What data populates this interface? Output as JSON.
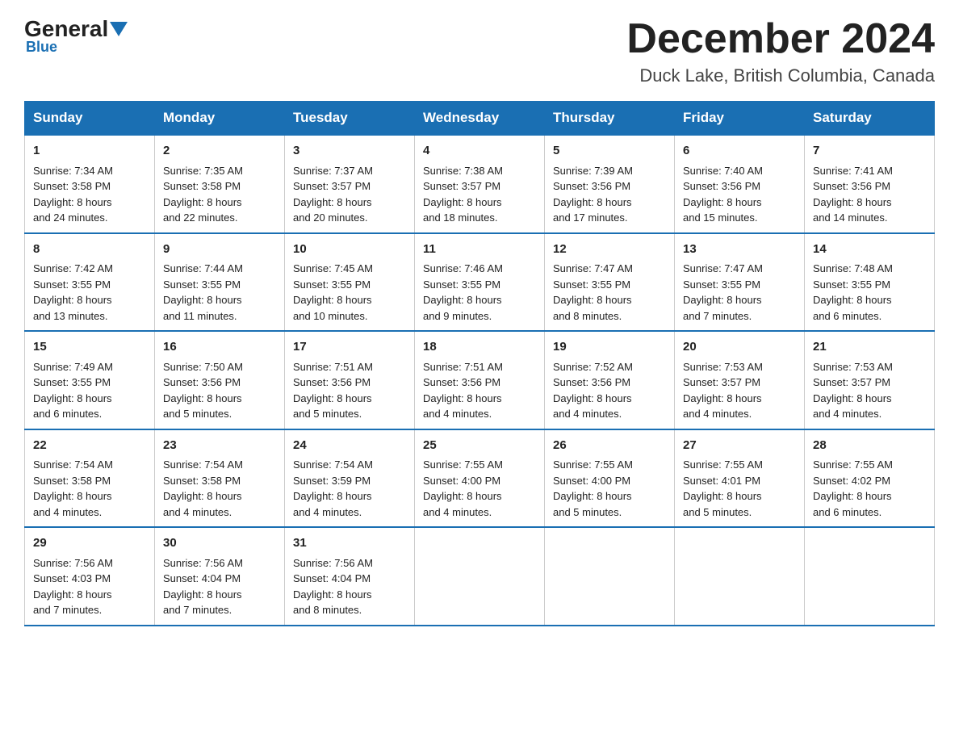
{
  "header": {
    "logo_general": "General",
    "logo_blue": "Blue",
    "month_title": "December 2024",
    "location": "Duck Lake, British Columbia, Canada"
  },
  "weekdays": [
    "Sunday",
    "Monday",
    "Tuesday",
    "Wednesday",
    "Thursday",
    "Friday",
    "Saturday"
  ],
  "weeks": [
    [
      {
        "day": "1",
        "sunrise": "7:34 AM",
        "sunset": "3:58 PM",
        "daylight": "8 hours and 24 minutes."
      },
      {
        "day": "2",
        "sunrise": "7:35 AM",
        "sunset": "3:58 PM",
        "daylight": "8 hours and 22 minutes."
      },
      {
        "day": "3",
        "sunrise": "7:37 AM",
        "sunset": "3:57 PM",
        "daylight": "8 hours and 20 minutes."
      },
      {
        "day": "4",
        "sunrise": "7:38 AM",
        "sunset": "3:57 PM",
        "daylight": "8 hours and 18 minutes."
      },
      {
        "day": "5",
        "sunrise": "7:39 AM",
        "sunset": "3:56 PM",
        "daylight": "8 hours and 17 minutes."
      },
      {
        "day": "6",
        "sunrise": "7:40 AM",
        "sunset": "3:56 PM",
        "daylight": "8 hours and 15 minutes."
      },
      {
        "day": "7",
        "sunrise": "7:41 AM",
        "sunset": "3:56 PM",
        "daylight": "8 hours and 14 minutes."
      }
    ],
    [
      {
        "day": "8",
        "sunrise": "7:42 AM",
        "sunset": "3:55 PM",
        "daylight": "8 hours and 13 minutes."
      },
      {
        "day": "9",
        "sunrise": "7:44 AM",
        "sunset": "3:55 PM",
        "daylight": "8 hours and 11 minutes."
      },
      {
        "day": "10",
        "sunrise": "7:45 AM",
        "sunset": "3:55 PM",
        "daylight": "8 hours and 10 minutes."
      },
      {
        "day": "11",
        "sunrise": "7:46 AM",
        "sunset": "3:55 PM",
        "daylight": "8 hours and 9 minutes."
      },
      {
        "day": "12",
        "sunrise": "7:47 AM",
        "sunset": "3:55 PM",
        "daylight": "8 hours and 8 minutes."
      },
      {
        "day": "13",
        "sunrise": "7:47 AM",
        "sunset": "3:55 PM",
        "daylight": "8 hours and 7 minutes."
      },
      {
        "day": "14",
        "sunrise": "7:48 AM",
        "sunset": "3:55 PM",
        "daylight": "8 hours and 6 minutes."
      }
    ],
    [
      {
        "day": "15",
        "sunrise": "7:49 AM",
        "sunset": "3:55 PM",
        "daylight": "8 hours and 6 minutes."
      },
      {
        "day": "16",
        "sunrise": "7:50 AM",
        "sunset": "3:56 PM",
        "daylight": "8 hours and 5 minutes."
      },
      {
        "day": "17",
        "sunrise": "7:51 AM",
        "sunset": "3:56 PM",
        "daylight": "8 hours and 5 minutes."
      },
      {
        "day": "18",
        "sunrise": "7:51 AM",
        "sunset": "3:56 PM",
        "daylight": "8 hours and 4 minutes."
      },
      {
        "day": "19",
        "sunrise": "7:52 AM",
        "sunset": "3:56 PM",
        "daylight": "8 hours and 4 minutes."
      },
      {
        "day": "20",
        "sunrise": "7:53 AM",
        "sunset": "3:57 PM",
        "daylight": "8 hours and 4 minutes."
      },
      {
        "day": "21",
        "sunrise": "7:53 AM",
        "sunset": "3:57 PM",
        "daylight": "8 hours and 4 minutes."
      }
    ],
    [
      {
        "day": "22",
        "sunrise": "7:54 AM",
        "sunset": "3:58 PM",
        "daylight": "8 hours and 4 minutes."
      },
      {
        "day": "23",
        "sunrise": "7:54 AM",
        "sunset": "3:58 PM",
        "daylight": "8 hours and 4 minutes."
      },
      {
        "day": "24",
        "sunrise": "7:54 AM",
        "sunset": "3:59 PM",
        "daylight": "8 hours and 4 minutes."
      },
      {
        "day": "25",
        "sunrise": "7:55 AM",
        "sunset": "4:00 PM",
        "daylight": "8 hours and 4 minutes."
      },
      {
        "day": "26",
        "sunrise": "7:55 AM",
        "sunset": "4:00 PM",
        "daylight": "8 hours and 5 minutes."
      },
      {
        "day": "27",
        "sunrise": "7:55 AM",
        "sunset": "4:01 PM",
        "daylight": "8 hours and 5 minutes."
      },
      {
        "day": "28",
        "sunrise": "7:55 AM",
        "sunset": "4:02 PM",
        "daylight": "8 hours and 6 minutes."
      }
    ],
    [
      {
        "day": "29",
        "sunrise": "7:56 AM",
        "sunset": "4:03 PM",
        "daylight": "8 hours and 7 minutes."
      },
      {
        "day": "30",
        "sunrise": "7:56 AM",
        "sunset": "4:04 PM",
        "daylight": "8 hours and 7 minutes."
      },
      {
        "day": "31",
        "sunrise": "7:56 AM",
        "sunset": "4:04 PM",
        "daylight": "8 hours and 8 minutes."
      },
      null,
      null,
      null,
      null
    ]
  ],
  "labels": {
    "sunrise": "Sunrise:",
    "sunset": "Sunset:",
    "daylight": "Daylight:"
  }
}
